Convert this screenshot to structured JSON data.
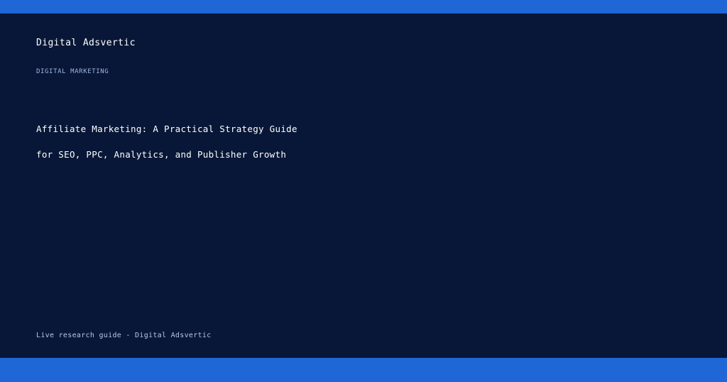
{
  "brand": "Digital Adsvertic",
  "category": "DIGITAL MARKETING",
  "headline": {
    "line1": "Affiliate Marketing: A Practical Strategy Guide",
    "line2": "for SEO, PPC, Analytics, and Publisher Growth"
  },
  "footer": "Live research guide - Digital Adsvertic",
  "colors": {
    "accent_bar": "#1f66d6",
    "panel_background": "#081737"
  }
}
